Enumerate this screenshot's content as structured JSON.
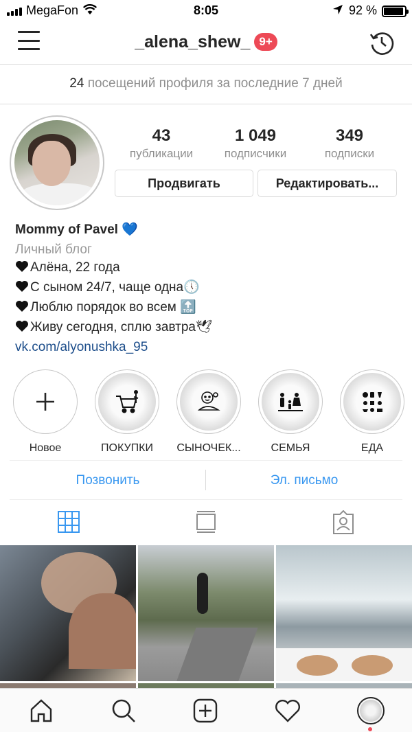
{
  "status_bar": {
    "carrier": "MegaFon",
    "time": "8:05",
    "battery": "92 %"
  },
  "header": {
    "username": "_alena_shew_",
    "notifications": "9+"
  },
  "visits": {
    "count": "24",
    "text": "посещений профиля за последние 7 дней"
  },
  "stats": [
    {
      "value": "43",
      "label": "публикации"
    },
    {
      "value": "1 049",
      "label": "подписчики"
    },
    {
      "value": "349",
      "label": "подписки"
    }
  ],
  "actions": {
    "promote": "Продвигать",
    "edit": "Редактировать..."
  },
  "bio": {
    "name": "Mommy of Pavel 💙",
    "category": "Личный блог",
    "lines": [
      "Алёна, 22 года",
      "С сыном 24/7, чаще одна🕔",
      "Люблю порядок во всем 🔝",
      "Живу сегодня, сплю завтра🕊"
    ],
    "link": "vk.com/alyonushka_95"
  },
  "highlights": [
    {
      "label": "Новое",
      "icon": "plus-icon"
    },
    {
      "label": "ПОКУПКИ",
      "icon": "shopping-cart-icon"
    },
    {
      "label": "СЫНОЧЕК...",
      "icon": "baby-icon"
    },
    {
      "label": "СЕМЬЯ",
      "icon": "family-icon"
    },
    {
      "label": "ЕДА",
      "icon": "food-icon"
    }
  ],
  "contact": {
    "call": "Позвонить",
    "email": "Эл. письмо"
  },
  "colors": {
    "accent": "#3897f0",
    "badge": "#ed4956",
    "link": "#1c4d8a"
  }
}
